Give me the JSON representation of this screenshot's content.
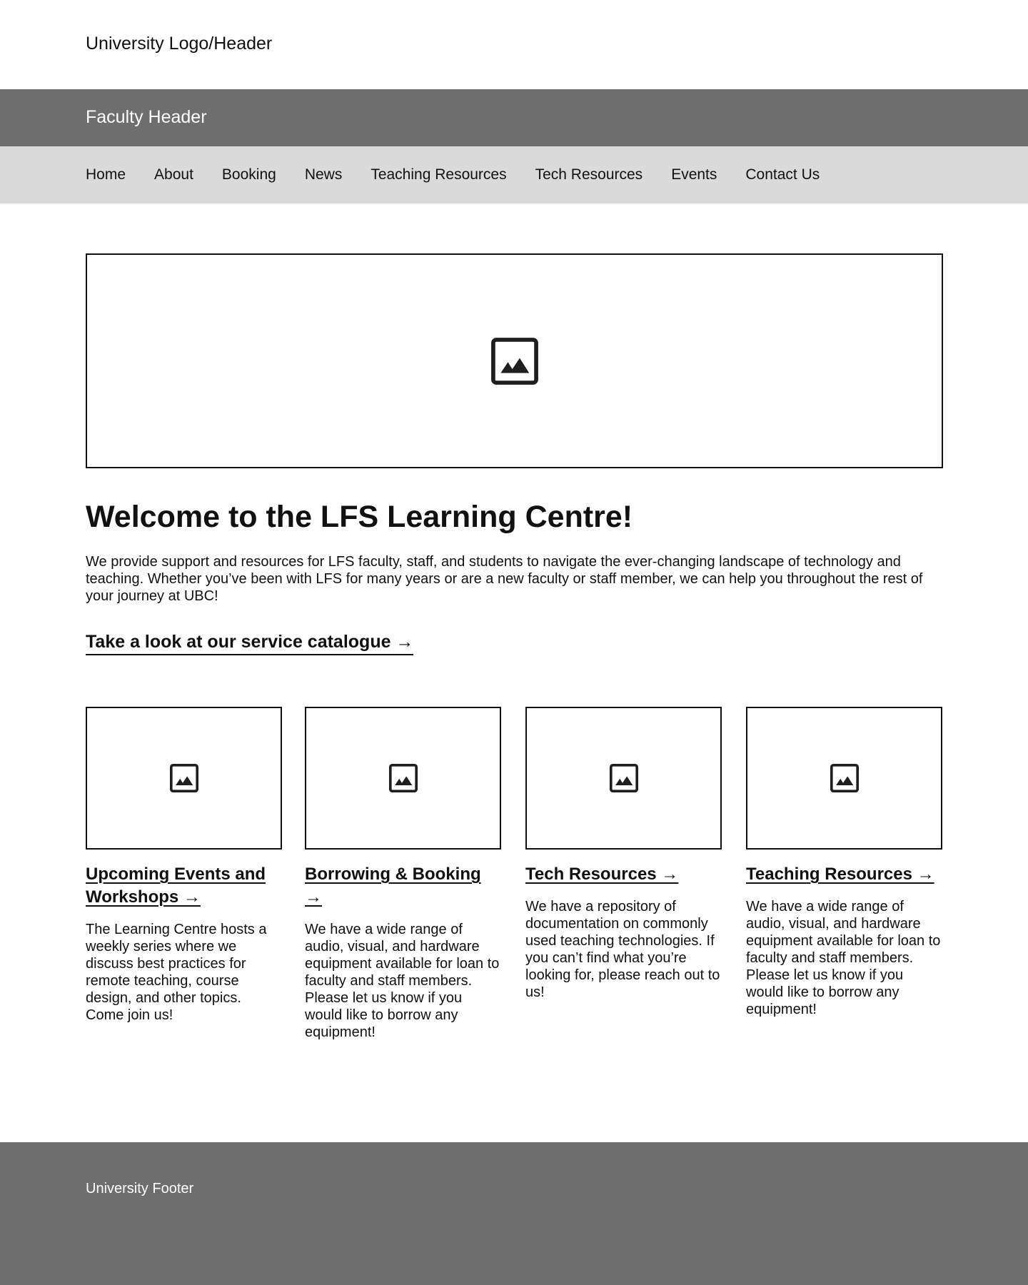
{
  "university_header": {
    "title": "University Logo/Header"
  },
  "faculty_header": {
    "title": "Faculty Header"
  },
  "nav": {
    "items": [
      {
        "label": "Home"
      },
      {
        "label": "About"
      },
      {
        "label": "Booking"
      },
      {
        "label": "News"
      },
      {
        "label": "Teaching Resources"
      },
      {
        "label": "Tech Resources"
      },
      {
        "label": "Events"
      },
      {
        "label": "Contact Us"
      }
    ]
  },
  "hero": {
    "icon": "image-placeholder-icon"
  },
  "welcome": {
    "title": "Welcome to the LFS Learning Centre!",
    "body": "We provide support and resources for LFS faculty, staff, and students to navigate the ever-changing landscape of technology and teaching. Whether you’ve been with LFS for many years or are a new faculty or staff member, we can help you throughout the rest of your journey at UBC!",
    "catalogue_link": "Take a look at our service catalogue →"
  },
  "cards": [
    {
      "icon": "image-placeholder-icon",
      "title": "Upcoming Events and Workshops →",
      "body": "The Learning Centre hosts a weekly series where we discuss best practices for remote teaching, course design, and other topics. Come join us!"
    },
    {
      "icon": "image-placeholder-icon",
      "title": "Borrowing & Booking →",
      "body": "We have a wide range of audio, visual, and hardware equipment available for loan to faculty and staff members. Please let us know if you would like to borrow any equipment!"
    },
    {
      "icon": "image-placeholder-icon",
      "title": "Tech Resources →",
      "body": "We have a repository of documentation on commonly used teaching technologies. If you can’t find what you’re looking for, please reach out to us!"
    },
    {
      "icon": "image-placeholder-icon",
      "title": "Teaching Resources →",
      "body": "We have a wide range of audio, visual, and hardware equipment available for loan to faculty and staff members. Please let us know if you would like to borrow any equipment!"
    }
  ],
  "footer": {
    "text": "University Footer"
  },
  "colors": {
    "header_gray": "#6e6e6e",
    "nav_gray": "#dadada",
    "text": "#111111",
    "white": "#ffffff"
  }
}
